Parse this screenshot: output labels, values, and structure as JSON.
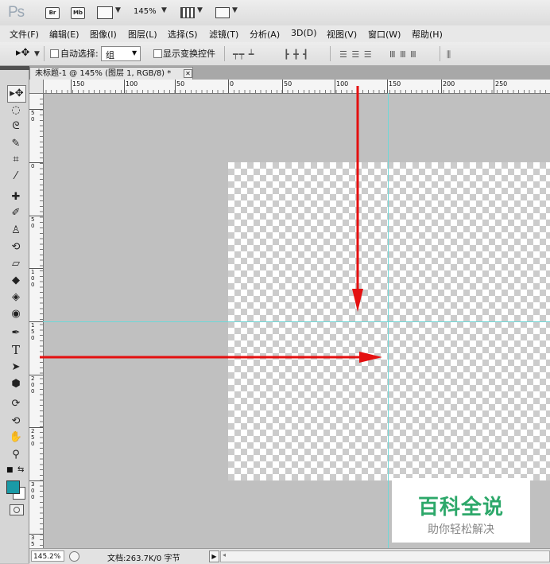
{
  "appbar": {
    "logo": "Ps",
    "bridge_label": "Br",
    "minibridge_label": "Mb",
    "zoom": "145%"
  },
  "menu": [
    "文件(F)",
    "编辑(E)",
    "图像(I)",
    "图层(L)",
    "选择(S)",
    "滤镜(T)",
    "分析(A)",
    "3D(D)",
    "视图(V)",
    "窗口(W)",
    "帮助(H)"
  ],
  "options": {
    "auto_select_label": "自动选择:",
    "auto_select_value": "组",
    "show_transform_label": "显示变换控件"
  },
  "document": {
    "tab_title": "未标题-1 @ 145% (图层 1, RGB/8) *",
    "close_glyph": "✕"
  },
  "ruler": {
    "h_labels": [
      "150",
      "100",
      "50",
      "0",
      "50",
      "100",
      "150",
      "200",
      "250"
    ],
    "v_labels": [
      "5\n0",
      "0",
      "5\n0",
      "1\n0\n0",
      "1\n5\n0",
      "2\n0\n0",
      "2\n5\n0",
      "3\n0\n0",
      "3\n5"
    ]
  },
  "watermark": {
    "main": "百科全说",
    "sub": "助你轻松解决"
  },
  "status": {
    "zoom": "145.2%",
    "doc_info": "文档:263.7K/0 字节"
  },
  "colors": {
    "annotation_arrow": "#e41010",
    "guide": "#6fd7d7",
    "foreground": "#1a9aa6",
    "watermark_green": "#2da86a"
  },
  "tools": [
    "move-icon",
    "marquee-icon",
    "lasso-icon",
    "quick-select-icon",
    "crop-icon",
    "eyedropper-icon",
    "healing-brush-icon",
    "brush-icon",
    "clone-stamp-icon",
    "history-brush-icon",
    "eraser-icon",
    "paint-bucket-icon",
    "blur-icon",
    "dodge-icon",
    "pen-icon",
    "type-icon",
    "path-select-icon",
    "shape-icon",
    "3d-rotate-icon",
    "3d-orbit-icon",
    "hand-icon",
    "zoom-icon"
  ]
}
